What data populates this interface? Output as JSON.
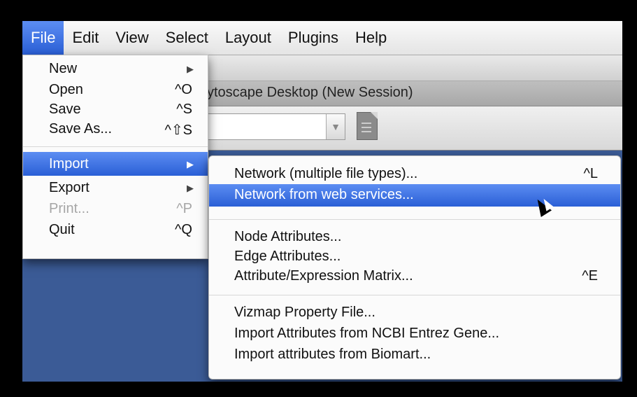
{
  "menubar": {
    "items": [
      "File",
      "Edit",
      "View",
      "Select",
      "Layout",
      "Plugins",
      "Help"
    ]
  },
  "window": {
    "title": "ytoscape Desktop (New Session)"
  },
  "file_menu": {
    "new": {
      "label": "New"
    },
    "open": {
      "label": "Open",
      "shortcut": "^O"
    },
    "save": {
      "label": "Save",
      "shortcut": "^S"
    },
    "save_as": {
      "label": "Save As...",
      "shortcut": "^⇧S"
    },
    "import": {
      "label": "Import"
    },
    "export": {
      "label": "Export"
    },
    "print": {
      "label": "Print...",
      "shortcut": "^P"
    },
    "quit": {
      "label": "Quit",
      "shortcut": "^Q"
    }
  },
  "import_menu": {
    "network_multiple": {
      "label": "Network (multiple file types)...",
      "shortcut": "^L"
    },
    "network_web": {
      "label": "Network from web services..."
    },
    "node_attrs": {
      "label": "Node Attributes..."
    },
    "edge_attrs": {
      "label": "Edge Attributes..."
    },
    "attr_matrix": {
      "label": "Attribute/Expression Matrix...",
      "shortcut": "^E"
    },
    "vizmap": {
      "label": "Vizmap Property File..."
    },
    "ncbi": {
      "label": "Import Attributes from NCBI Entrez Gene..."
    },
    "biomart": {
      "label": "Import attributes from Biomart..."
    }
  },
  "colors": {
    "highlight": "#2f66db",
    "desktop": "#3b5b96"
  }
}
